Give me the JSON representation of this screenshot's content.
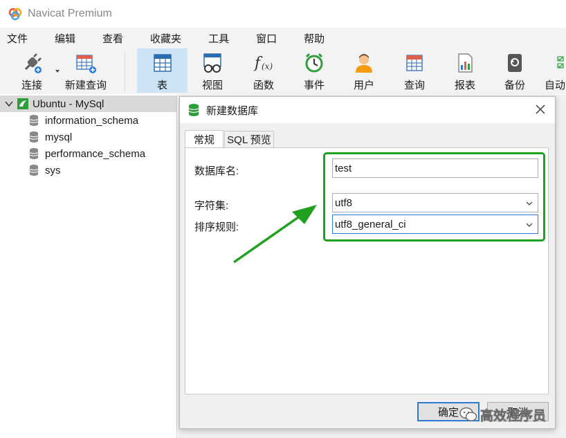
{
  "window": {
    "title": "Navicat Premium"
  },
  "menu": [
    "文件",
    "编辑",
    "查看",
    "收藏夹",
    "工具",
    "窗口",
    "帮助"
  ],
  "toolbar": {
    "connect_label": "连接",
    "new_query_label": "新建查询",
    "table_label": "表",
    "view_label": "视图",
    "function_label": "函数",
    "event_label": "事件",
    "user_label": "用户",
    "query_label": "查询",
    "report_label": "报表",
    "backup_label": "备份",
    "automation_label": "自动"
  },
  "sidebar": {
    "connection": "Ubuntu - MySql",
    "databases": [
      "information_schema",
      "mysql",
      "performance_schema",
      "sys"
    ]
  },
  "dialog": {
    "title": "新建数据库",
    "tabs": [
      "常规",
      "SQL 预览"
    ],
    "db_name_label": "数据库名:",
    "db_name_value": "test",
    "charset_label": "字符集:",
    "charset_value": "utf8",
    "collation_label": "排序规则:",
    "collation_value": "utf8_general_ci",
    "ok_label": "确定",
    "cancel_label": "取消"
  },
  "watermark": "高效程序员",
  "colors": {
    "annotation_green": "#1fa01f",
    "selection_blue": "#cde4f7",
    "focus_blue": "#2b7bd4"
  }
}
